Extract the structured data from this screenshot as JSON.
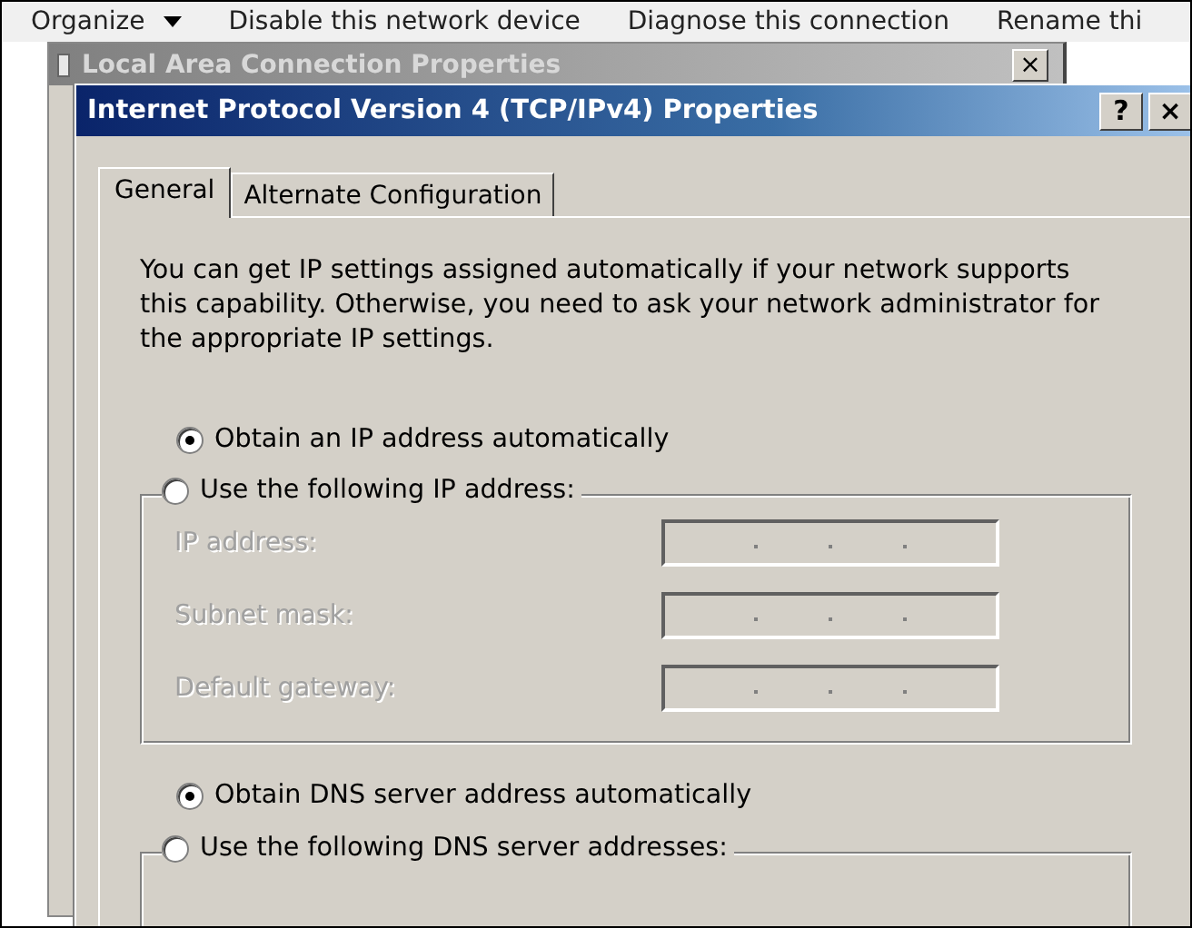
{
  "explorer_toolbar": {
    "items": [
      {
        "label": "Organize",
        "has_menu": true
      },
      {
        "label": "Disable this network device",
        "has_menu": false
      },
      {
        "label": "Diagnose this connection",
        "has_menu": false
      },
      {
        "label": "Rename thi",
        "has_menu": false
      }
    ]
  },
  "background_window": {
    "title": "Local Area Connection Properties",
    "buttons": [
      "×"
    ]
  },
  "dialog": {
    "title": "Internet Protocol Version 4 (TCP/IPv4) Properties",
    "buttons": [
      "?",
      "×"
    ]
  },
  "tabs": [
    {
      "label": "General",
      "selected": true
    },
    {
      "label": "Alternate Configuration",
      "selected": false
    }
  ],
  "intro": "You can get IP settings assigned automatically if your network supports this capability. Otherwise, you need to ask your network administrator for the appropriate IP settings.",
  "ip_options": [
    {
      "label": "Obtain an IP address automatically",
      "selected": true
    },
    {
      "label": "Use the following IP address:",
      "selected": false
    }
  ],
  "ip_fields": {
    "disabled": true,
    "fields": [
      {
        "label": "IP address:"
      },
      {
        "label": "Subnet mask:"
      },
      {
        "label": "Default gateway:"
      }
    ]
  },
  "dns_options": [
    {
      "label": "Obtain DNS server address automatically",
      "selected": true
    },
    {
      "label": "Use the following DNS server addresses:",
      "selected": false
    }
  ]
}
